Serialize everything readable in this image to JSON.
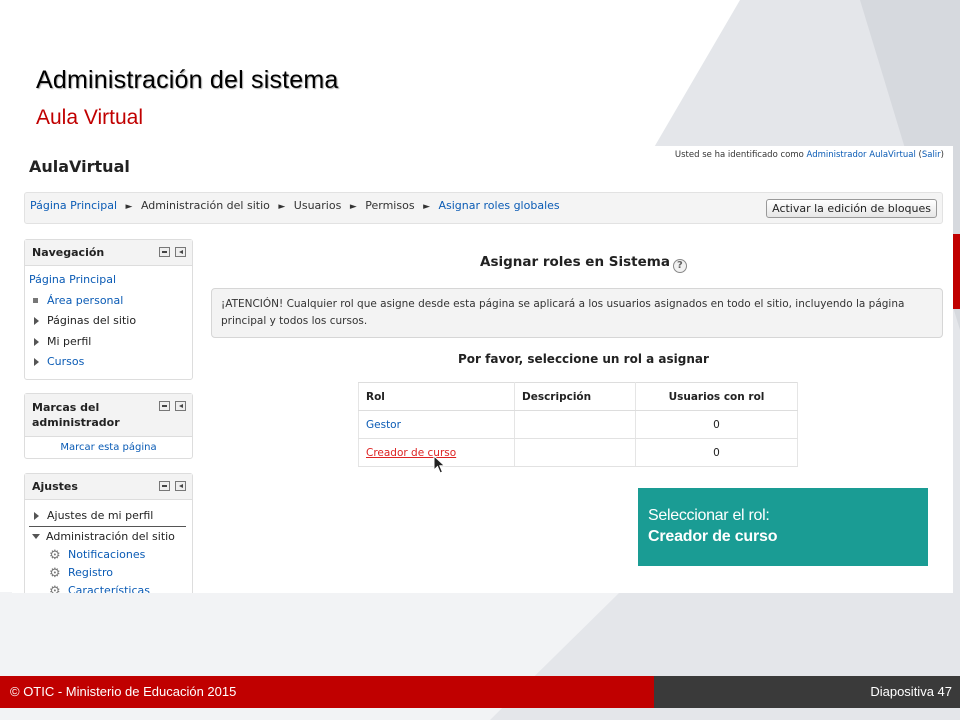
{
  "slide": {
    "title": "Administración del sistema",
    "subtitle": "Aula Virtual",
    "footer_left": "© OTIC - Ministerio de Educación 2015",
    "footer_right": "Diapositiva 47",
    "colors": {
      "accent_red": "#c00000",
      "callout_teal": "#1a9c94",
      "footer_dark": "#3a3a3a"
    }
  },
  "moodle": {
    "brand": "AulaVirtual",
    "login": {
      "prefix": "Usted se ha identificado como ",
      "user": "Administrador AulaVirtual",
      "open": " (",
      "logout": "Salir",
      "close": ")"
    },
    "breadcrumb": [
      "Página Principal",
      "Administración del sitio",
      "Usuarios",
      "Permisos",
      "Asignar roles globales"
    ],
    "breadcrumb_sep": "►",
    "edit_blocks_button": "Activar la edición de bloques",
    "navigation": {
      "title": "Navegación",
      "items": [
        "Página Principal",
        "Área personal",
        "Páginas del sitio",
        "Mi perfil",
        "Cursos"
      ]
    },
    "admin_bookmarks": {
      "title": "Marcas del administrador",
      "link": "Marcar esta página"
    },
    "settings": {
      "title": "Ajustes",
      "items": [
        "Ajustes de mi perfil",
        "Administración del sitio"
      ],
      "subitems": [
        "Notificaciones",
        "Registro",
        "Características"
      ]
    },
    "main": {
      "heading": "Asignar roles en Sistema",
      "help": "?",
      "warning": "¡ATENCIÓN! Cualquier rol que asigne desde esta página se aplicará a los usuarios asignados en todo el sitio, incluyendo la página principal y todos los cursos.",
      "prompt": "Por favor, seleccione un rol a asignar",
      "table": {
        "headers": [
          "Rol",
          "Descripción",
          "Usuarios con rol"
        ],
        "rows": [
          {
            "role": "Gestor",
            "description": "",
            "users": "0"
          },
          {
            "role": "Creador de curso",
            "description": "",
            "users": "0"
          }
        ]
      }
    }
  },
  "callout": {
    "line1": "Seleccionar el rol:",
    "line2": "Creador de curso"
  }
}
